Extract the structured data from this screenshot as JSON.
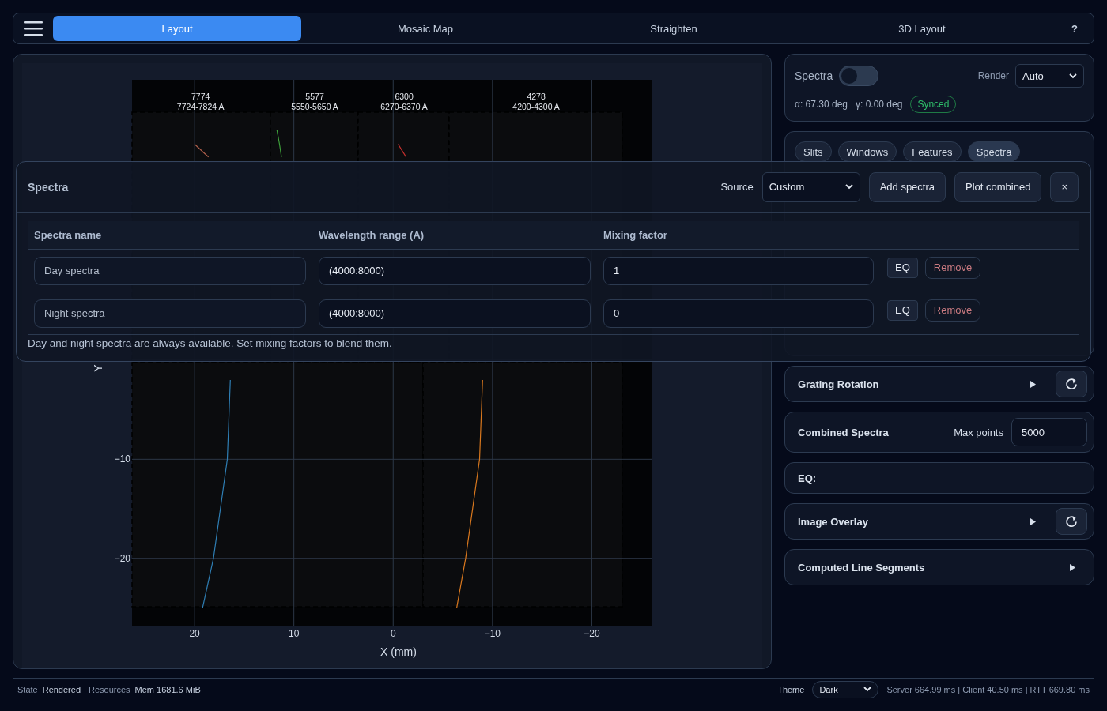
{
  "top_bar": {
    "tabs": [
      {
        "label": "Layout",
        "selected": true
      },
      {
        "label": "Mosaic Map",
        "selected": false
      },
      {
        "label": "Straighten",
        "selected": false
      },
      {
        "label": "3D Layout",
        "selected": false
      }
    ],
    "help": "?"
  },
  "plot": {
    "chart_data": {
      "type": "line",
      "orientation": "horizontal",
      "xlabel": "X (mm)",
      "ylabel": "Y",
      "x": [
        -25,
        -20,
        -10,
        -2,
        20.5,
        21.8,
        23.2
      ],
      "xlim": [
        26.3,
        -26.1
      ],
      "ylim": [
        -26.8,
        28.3
      ],
      "xticks": [
        20,
        10,
        0,
        -10,
        -20
      ],
      "yticks": [
        {
          "value": -10,
          "label": "−10"
        },
        {
          "value": -20,
          "label": "−20"
        }
      ],
      "grid": true,
      "series": [
        {
          "color": "#2f7fb5",
          "values": [
            19.2,
            18.1,
            16.7,
            16.4,
            null,
            null,
            null
          ]
        },
        {
          "color": "#d9781e",
          "values": [
            -6.4,
            -7.3,
            -8.7,
            -9.0,
            null,
            null,
            null
          ]
        },
        {
          "color": "#b0604c",
          "values": [
            null,
            null,
            null,
            null,
            18.6,
            20.0,
            null
          ]
        },
        {
          "color": "#3ea03a",
          "values": [
            null,
            null,
            null,
            null,
            11.25,
            11.45,
            11.7
          ]
        },
        {
          "color": "#c8302e",
          "values": [
            null,
            null,
            null,
            null,
            -1.3,
            -0.5,
            null
          ]
        }
      ],
      "annotations": [
        "7774",
        "7724-7824 A",
        "5577",
        "5550-5650 A",
        "6300",
        "6270-6370 A",
        "4278",
        "4200-4300 A"
      ]
    }
  },
  "spectra_card": {
    "label": "Spectra",
    "enabled": false,
    "render_label": "Render",
    "render": "Auto",
    "alpha": "α: 67.30 deg",
    "gamma": "γ: 0.00 deg",
    "status": "Synced"
  },
  "chips": [
    {
      "label": "Slits",
      "selected": false
    },
    {
      "label": "Windows",
      "selected": false
    },
    {
      "label": "Features",
      "selected": false
    },
    {
      "label": "Spectra",
      "selected": true
    }
  ],
  "sections": [
    {
      "kind": "collapsible",
      "title": "Grating Rotation",
      "expanded": false,
      "reset": true
    },
    {
      "kind": "field",
      "title": "Combined Spectra",
      "field_label": "Max points",
      "value": "5000"
    },
    {
      "kind": "plain",
      "title": "EQ:"
    },
    {
      "kind": "collapsible",
      "title": "Image Overlay",
      "expanded": false,
      "reset": true
    },
    {
      "kind": "collapsible",
      "title": "Computed Line Segments",
      "expanded": false,
      "reset": false
    }
  ],
  "dialog": {
    "title": "Spectra",
    "source_label": "Source",
    "source": "Custom",
    "buttons": [
      "Add spectra",
      "Plot combined"
    ],
    "close": "×",
    "columns": [
      "Spectra name",
      "Wavelength range (A)",
      "Mixing factor"
    ],
    "rows": [
      {
        "name": "Day spectra",
        "range": "(4000:8000)",
        "mix": "1",
        "eq": "EQ",
        "remove": "Remove"
      },
      {
        "name": "Night spectra",
        "range": "(4000:8000)",
        "mix": "0",
        "eq": "EQ",
        "remove": "Remove"
      }
    ],
    "note": "Day and night spectra are always available. Set mixing factors to blend them."
  },
  "status_bar": {
    "state_label": "State",
    "state": "Rendered",
    "resources_label": "Resources",
    "memory": "Mem 1681.6 MiB",
    "theme_label": "Theme",
    "theme": "Dark",
    "timings": "Server 664.99 ms | Client 40.50 ms | RTT 669.80 ms"
  }
}
